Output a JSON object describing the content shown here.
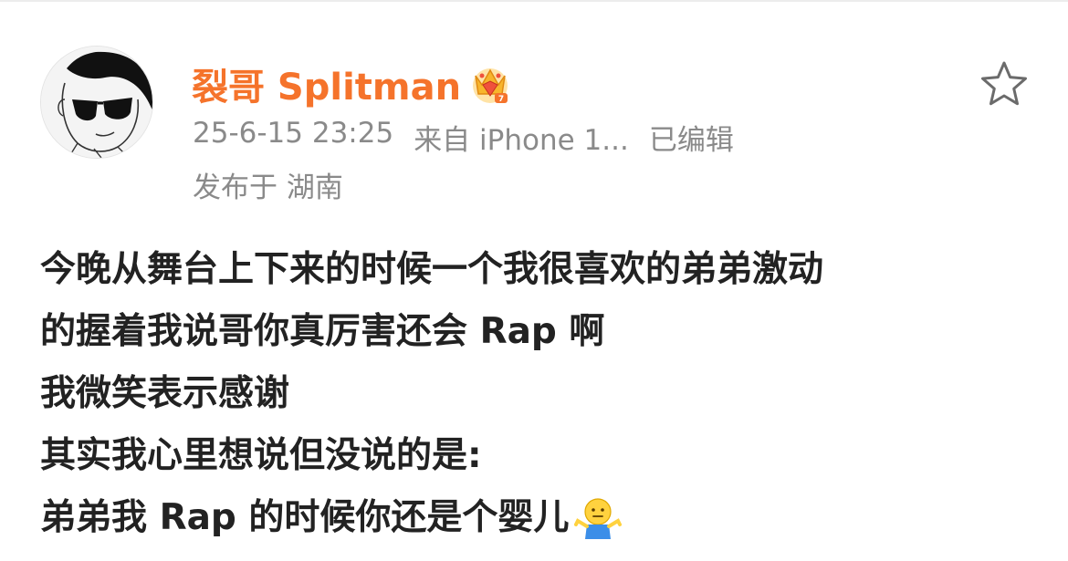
{
  "author": {
    "name": "裂哥 Splitman",
    "avatar_icon": "sunglasses-man-avatar",
    "badge_icon": "vip-crown-badge-icon",
    "name_color": "#f5732b"
  },
  "post_meta": {
    "timestamp": "25-6-15 23:25",
    "source": "来自 iPhone 1...",
    "edited": "已编辑",
    "location": "发布于 湖南"
  },
  "actions": {
    "favorite_icon": "star-outline-icon"
  },
  "post": {
    "lines": [
      "今晚从舞台上下来的时候一个我很喜欢的弟弟激动",
      "的握着我说哥你真厉害还会 Rap 啊",
      "我微笑表示感谢",
      "其实我心里想说但没说的是:",
      "弟弟我 Rap 的时候你还是个婴儿"
    ],
    "trailing_emoji": "shrug-emoji-icon"
  }
}
